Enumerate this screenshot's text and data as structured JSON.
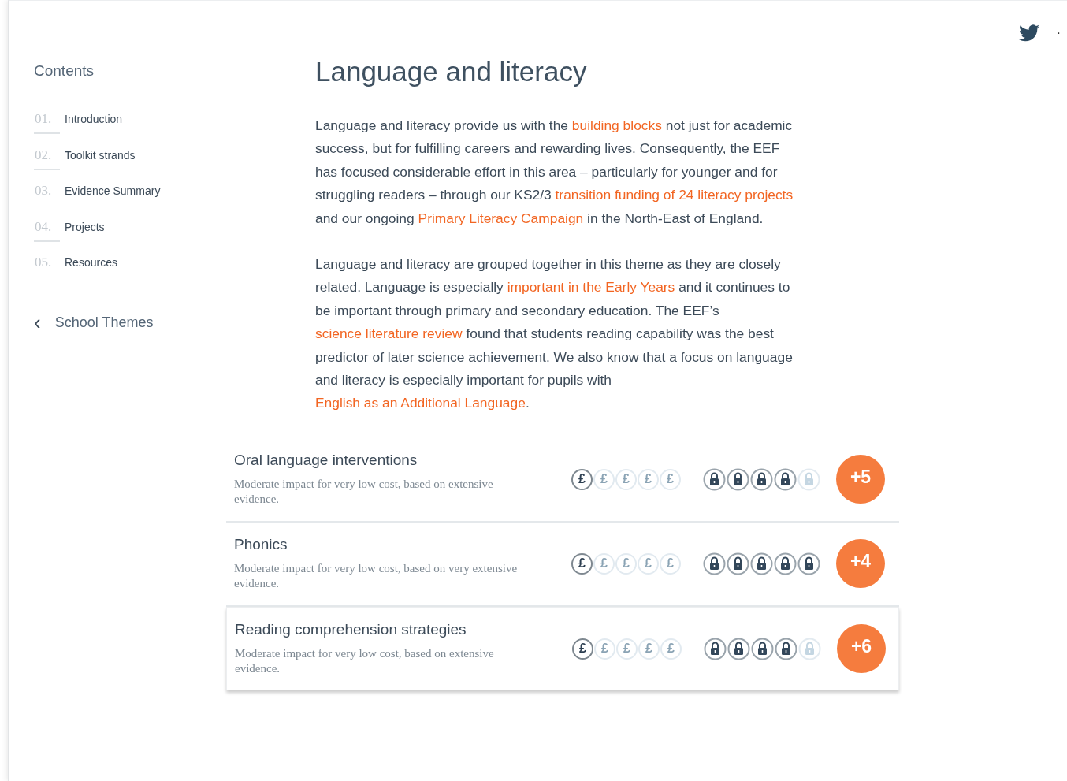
{
  "sidebar": {
    "title": "Contents",
    "items": [
      {
        "number": "01.",
        "label": "Introduction",
        "underlined": true
      },
      {
        "number": "02.",
        "label": "Toolkit strands",
        "underlined": true
      },
      {
        "number": "03.",
        "label": "Evidence Summary",
        "underlined": false
      },
      {
        "number": "04.",
        "label": "Projects",
        "underlined": true
      },
      {
        "number": "05.",
        "label": "Resources",
        "underlined": false
      }
    ],
    "back_link": {
      "icon": "‹",
      "label": "School Themes"
    }
  },
  "social": {
    "separator": "·"
  },
  "article": {
    "title": "Language and literacy",
    "paragraphs": [
      [
        {
          "text": "Language and literacy provide us with the ",
          "kind": "text"
        },
        {
          "text": "building blocks",
          "kind": "link"
        },
        {
          "text": " not just for academic success, but for fulfilling careers and rewarding lives. Consequently, the EEF has focused considerable effort in this area – particularly for younger and for struggling readers – through our KS2/3 ",
          "kind": "text"
        },
        {
          "text": "transition funding of 24 literacy projects",
          "kind": "link"
        },
        {
          "text": " and our ongoing ",
          "kind": "text"
        },
        {
          "text": "Primary Literacy Campaign",
          "kind": "link"
        },
        {
          "text": " in the North-East of England.",
          "kind": "text"
        }
      ],
      [
        {
          "text": "Language and literacy are grouped together in this theme as they are closely related. Language is especially ",
          "kind": "text"
        },
        {
          "text": "important in the Early Years",
          "kind": "link"
        },
        {
          "text": " and it continues to be important through primary and secondary education. The EEF’s ",
          "kind": "text"
        },
        {
          "text": "science literature review",
          "kind": "link"
        },
        {
          "text": " found that students reading capability was the best predictor of later science achievement. We also know that a focus on language and literacy is especially important for pupils with ",
          "kind": "text"
        },
        {
          "text": "English as an Additional Language",
          "kind": "link"
        },
        {
          "text": ".",
          "kind": "text"
        }
      ]
    ]
  },
  "strands": [
    {
      "title": "Oral language interventions",
      "summary": "Moderate impact for very low cost, based on extensive evidence.",
      "cost": [
        {
          "symbol": "£",
          "active": true
        },
        {
          "symbol": "£",
          "active": false
        },
        {
          "symbol": "£",
          "active": false
        },
        {
          "symbol": "£",
          "active": false
        },
        {
          "symbol": "£",
          "active": false
        }
      ],
      "evidence": {
        "stars": 4
      },
      "impact": "+5",
      "raised": false
    },
    {
      "title": "Phonics",
      "summary": "Moderate impact for very low cost, based on very extensive evidence.",
      "cost": [
        {
          "symbol": "£",
          "active": true
        },
        {
          "symbol": "£",
          "active": false
        },
        {
          "symbol": "£",
          "active": false
        },
        {
          "symbol": "£",
          "active": false
        },
        {
          "symbol": "£",
          "active": false
        }
      ],
      "evidence": {
        "stars": 5
      },
      "impact": "+4",
      "raised": false
    },
    {
      "title": "Reading comprehension strategies",
      "summary": "Moderate impact for very low cost, based on extensive evidence.",
      "cost": [
        {
          "symbol": "£",
          "active": true
        },
        {
          "symbol": "£",
          "active": false
        },
        {
          "symbol": "£",
          "active": false
        },
        {
          "symbol": "£",
          "active": false
        },
        {
          "symbol": "£",
          "active": false
        }
      ],
      "evidence": {
        "stars": 4
      },
      "impact": "+6",
      "raised": true
    }
  ]
}
